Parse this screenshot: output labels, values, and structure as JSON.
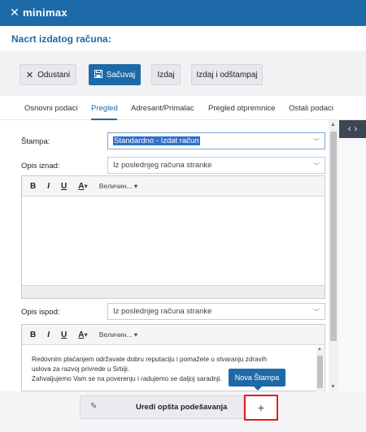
{
  "app": {
    "brand": "minimax",
    "brand_icon": "x-logo-icon"
  },
  "page": {
    "title": "Nacrt izdatog računa:"
  },
  "toolbar": {
    "cancel_label": "Odustani",
    "save_label": "Sačuvaj",
    "issue_label": "Izdaj",
    "issue_print_label": "Izdaj i odštampaj"
  },
  "tabs": [
    {
      "label": "Osnovni podaci",
      "active": false
    },
    {
      "label": "Pregled",
      "active": true
    },
    {
      "label": "Adresant/Primalac",
      "active": false
    },
    {
      "label": "Pregled otpremnice",
      "active": false
    },
    {
      "label": "Ostali podaci",
      "active": false
    }
  ],
  "form": {
    "stampa": {
      "label": "Štampa:",
      "value": "Standardno - Izdat račun"
    },
    "opis_iznad": {
      "label": "Opis iznad:",
      "value": "Iz poslednjeg računa stranke"
    },
    "opis_ispod": {
      "label": "Opis ispod:",
      "value": "Iz poslednjeg računa stranke"
    },
    "editor_toolbar": {
      "bold": "B",
      "italic": "I",
      "underline": "U",
      "color": "A",
      "color_arrow": "▾",
      "size": "Величин...",
      "size_arrow": "▾"
    },
    "bottom_text": [
      "Redovnim plaćanjem održavate dobru reputaciju i pomažete u stvaranju zdravih",
      "uslova za razvoj privrede u Srbiji.",
      "Zahvaljujemo Vam se na poverenju i radujemo se daljoj saradnji."
    ]
  },
  "side_nav": {
    "prev": "‹",
    "next": "›"
  },
  "bottom": {
    "general_settings_label": "Uredi opšta podešavanja",
    "add_label": "+",
    "tooltip": "Nova Štampa"
  },
  "colors": {
    "brand": "#1e6aa8",
    "highlight": "#e02020"
  }
}
